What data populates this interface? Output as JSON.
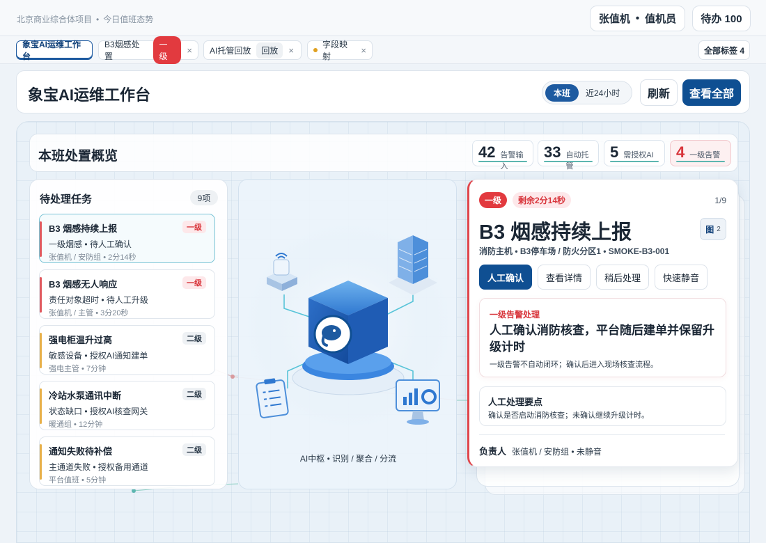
{
  "topbar": {
    "project": "北京商业综合体项目",
    "dot": "•",
    "subtitle": "今日值班态势",
    "user_name": "张值机",
    "user_role": "值机员",
    "todo": "待办 100"
  },
  "tabs": {
    "workbench": "象宝AI运维工作台",
    "smoke": "B3烟感处置",
    "smoke_badge": "一级",
    "ai_replay": "AI托管回放",
    "ai_replay_badge": "回放",
    "field_map": "字段映射",
    "close": "×",
    "all_tags": "全部标签 4"
  },
  "header": {
    "title": "象宝AI运维工作台",
    "seg_on": "本班",
    "seg_off": "近24小时",
    "refresh": "刷新",
    "view_all": "查看全部"
  },
  "overview": {
    "title": "本班处置概览",
    "stats": [
      {
        "num": "42",
        "label": "告警输入"
      },
      {
        "num": "33",
        "label": "自动托管"
      },
      {
        "num": "5",
        "label": "需授权AI"
      },
      {
        "num": "4",
        "label": "一级告警"
      }
    ]
  },
  "tasks": {
    "title": "待处理任务",
    "count": "9项",
    "items": [
      {
        "title": "B3 烟感持续上报",
        "level": "一级",
        "desc": "一级烟感 • 待人工确认",
        "meta": "张值机 / 安防组 • 2分14秒"
      },
      {
        "title": "B3 烟感无人响应",
        "level": "一级",
        "desc": "责任对象超时 • 待人工升级",
        "meta": "张值机 / 主管 • 3分20秒"
      },
      {
        "title": "强电柜温升过高",
        "level": "二级",
        "desc": "敏感设备 • 授权AI通知建单",
        "meta": "强电主管 • 7分钟"
      },
      {
        "title": "冷站水泵通讯中断",
        "level": "二级",
        "desc": "状态缺口 • 授权AI核查网关",
        "meta": "暖通组 • 12分钟"
      },
      {
        "title": "通知失败待补偿",
        "level": "二级",
        "desc": "主通道失败 • 授权备用通道",
        "meta": "平台值班 • 5分钟"
      }
    ]
  },
  "center": {
    "caption": "AI中枢 • 识别 / 聚合 / 分流"
  },
  "detail": {
    "level": "一级",
    "timer": "剩余2分14秒",
    "page": "1/9",
    "title": "B3 烟感持续上报",
    "image_label": "图",
    "image_count": "2",
    "location": "消防主机 • B3停车场 / 防火分区1 • SMOKE-B3-001",
    "actions": [
      "人工确认",
      "查看详情",
      "稍后处理",
      "快速静音"
    ],
    "box1_kicker": "一级告警处理",
    "box1_headline": "人工确认消防核查，平台随后建单并保留升级计时",
    "box1_note": "一级告警不自动闭环；确认后进入现场核查流程。",
    "box2_title": "人工处理要点",
    "box2_note": "确认是否启动消防核查；未确认继续升级计时。",
    "owner_label": "负责人",
    "owner_value": "张值机 / 安防组 • 未静音"
  },
  "colors": {
    "primary": "#0f4f92",
    "alert": "#e23a3f",
    "level2": "#e8b04a",
    "accent": "#5db6b0"
  }
}
